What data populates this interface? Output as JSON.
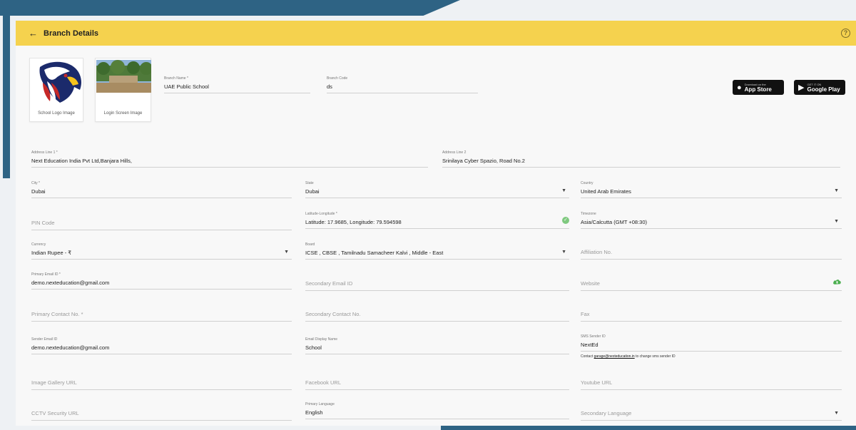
{
  "header": {
    "back_icon": "arrow-left-icon",
    "title": "Branch Details",
    "help_icon": "help-circle-icon"
  },
  "images": {
    "logo_caption": "School Logo Image",
    "login_caption": "Login Screen Image"
  },
  "stores": {
    "app_store": {
      "small": "Download on the",
      "label": "App Store"
    },
    "google_play": {
      "small": "GET IT ON",
      "label": "Google Play"
    }
  },
  "fields": {
    "branch_name": {
      "label": "Branch Name *",
      "value": "UAE Public School"
    },
    "branch_code": {
      "label": "Branch Code",
      "value": "ds"
    },
    "address1": {
      "label": "Address Line 1 *",
      "value": "Next Education India Pvt Ltd,Banjara Hills,"
    },
    "address2": {
      "label": "Address Line 2",
      "value": "Srinilaya Cyber Spazio, Road No.2"
    },
    "city": {
      "label": "City *",
      "value": "Dubai"
    },
    "state": {
      "label": "State",
      "value": "Dubai"
    },
    "country": {
      "label": "Country",
      "value": "United Arab Emirates"
    },
    "pin": {
      "placeholder": "PIN Code"
    },
    "latlong": {
      "label": "Latitude-Longitude *",
      "value": "Latitude: 17.9685, Longitude: 79.594598"
    },
    "timezone": {
      "label": "Timezone",
      "value": "Asia/Calcutta (GMT +08:30)"
    },
    "currency": {
      "label": "Currency",
      "value": "Indian Rupee - ₹"
    },
    "board": {
      "label": "Board",
      "value": "ICSE , CBSE , Tamilnadu Samacheer Kalvi , Middle - East"
    },
    "affiliation": {
      "placeholder": "Affiliation No."
    },
    "primary_email": {
      "label": "Primary Email ID *",
      "value": "demo.nexteducation@gmail.com"
    },
    "secondary_email": {
      "placeholder": "Secondary Email ID"
    },
    "website": {
      "placeholder": "Website"
    },
    "primary_contact": {
      "placeholder": "Primary Contact No. *"
    },
    "secondary_contact": {
      "placeholder": "Secondary Contact No."
    },
    "fax": {
      "placeholder": "Fax"
    },
    "sender_email": {
      "label": "Sender Email ID",
      "value": "demo.nexteducation@gmail.com"
    },
    "email_display": {
      "label": "Email Display Name",
      "value": "School"
    },
    "sms_sender": {
      "label": "SMS Sender ID",
      "value": "NextEd"
    },
    "sms_hint": {
      "prefix": "Contact",
      "email": "garage@nexteducation.in",
      "suffix": "to change sms sender ID"
    },
    "gallery": {
      "placeholder": "Image Gallery URL"
    },
    "facebook": {
      "placeholder": "Facebook URL"
    },
    "youtube": {
      "placeholder": "Youtube URL"
    },
    "cctv": {
      "placeholder": "CCTV Security URL"
    },
    "primary_language": {
      "label": "Primary Language",
      "value": "English"
    },
    "secondary_language": {
      "placeholder": "Secondary Language"
    }
  },
  "colors": {
    "header": "#f5d24e",
    "frame": "#2e6384",
    "accent_green": "#4caf50"
  }
}
